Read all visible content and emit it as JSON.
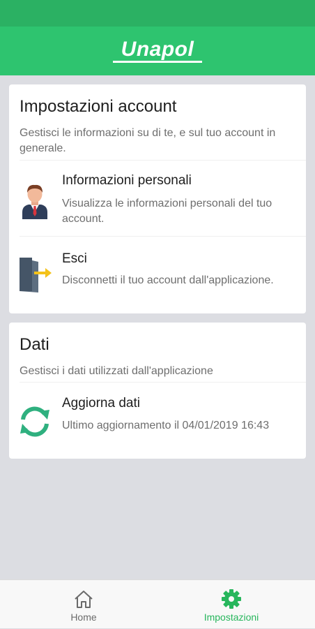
{
  "app": {
    "title": "Unapol"
  },
  "account_section": {
    "title": "Impostazioni account",
    "description": "Gestisci le informazioni su di te, e sul tuo account in generale.",
    "items": [
      {
        "title": "Informazioni personali",
        "description": "Visualizza le informazioni personali del tuo account.",
        "icon": "person-icon"
      },
      {
        "title": "Esci",
        "description": "Disconnetti il tuo account dall'applicazione.",
        "icon": "logout-door-icon"
      }
    ]
  },
  "data_section": {
    "title": "Dati",
    "description": "Gestisci i dati utilizzati dall'applicazione",
    "items": [
      {
        "title": "Aggiorna dati",
        "description": "Ultimo aggiornamento il 04/01/2019 16:43",
        "icon": "refresh-icon"
      }
    ]
  },
  "tabbar": {
    "tabs": [
      {
        "label": "Home",
        "icon": "home-icon",
        "active": false
      },
      {
        "label": "Impostazioni",
        "icon": "gear-icon",
        "active": true
      }
    ]
  },
  "colors": {
    "brand": "#2ec46f",
    "statusbar": "#2bb163",
    "background": "#dcdde2",
    "inactive": "#6a6a6a"
  }
}
